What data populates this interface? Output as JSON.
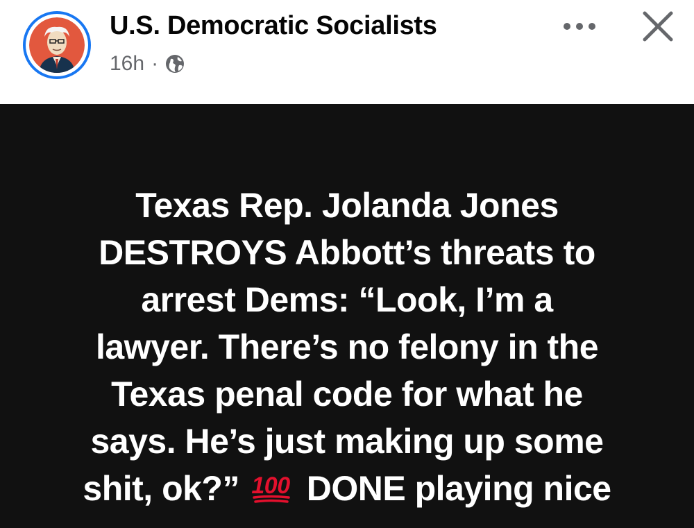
{
  "post": {
    "author": "U.S. Democratic Socialists",
    "time": "16h",
    "separator": "·",
    "audience_icon": "globe-icon",
    "more_icon": "more-options-icon",
    "close_icon": "close-icon"
  },
  "image_text": {
    "lines": [
      "Texas Rep. Jolanda Jones",
      "DESTROYS Abbott’s threats to",
      "arrest Dems: “Look, I’m a",
      "lawyer. There’s no felony in the",
      "Texas penal code for what he",
      "says. He’s just making up some"
    ],
    "last_line_start": "shit, ok?”",
    "emoji": "100",
    "last_line_end": "DONE playing nice"
  },
  "colors": {
    "accent": "#1877f2",
    "image_background": "#111111",
    "emoji_red": "#e3102d"
  }
}
